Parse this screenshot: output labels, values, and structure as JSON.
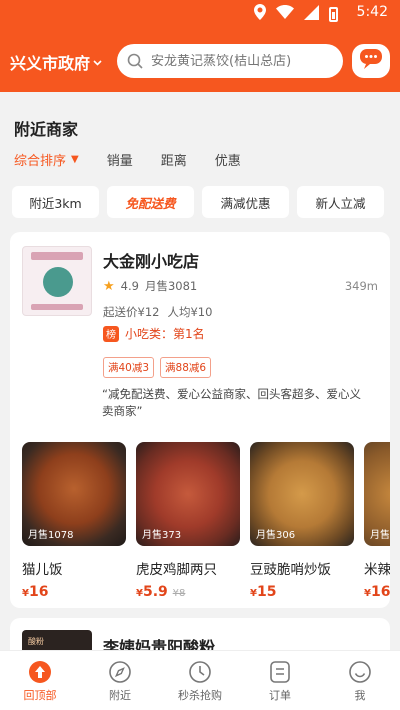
{
  "status_bar": {
    "time": "5:42"
  },
  "header": {
    "city": "兴义市政府",
    "search_placeholder": "安龙黄记蒸饺(桔山总店)"
  },
  "nearby": {
    "title": "附近商家",
    "sort_options": [
      {
        "label": "综合排序",
        "active": true
      },
      {
        "label": "销量"
      },
      {
        "label": "距离"
      },
      {
        "label": "优惠"
      }
    ],
    "filters": [
      {
        "label": "附近3km"
      },
      {
        "label": "免配送费",
        "highlighted": true
      },
      {
        "label": "满减优惠"
      },
      {
        "label": "新人立减"
      }
    ]
  },
  "stores": [
    {
      "name": "大金刚小吃店",
      "rating": "4.9",
      "monthly_sales": "月售3081",
      "distance": "349m",
      "min_order": "起送价¥12",
      "avg_price": "人均¥10",
      "rank_badge": "榜",
      "rank_text": "小吃类：第1名",
      "promotions": [
        "满40减3",
        "满88减6"
      ],
      "quote": "“减免配送费、爱心公益商家、回头客超多、爱心义卖商家”",
      "dishes": [
        {
          "name": "猫儿饭",
          "sales": "月售1078",
          "price": "16",
          "currency": "¥"
        },
        {
          "name": "虎皮鸡脚两只",
          "sales": "月售373",
          "price": "5.9",
          "currency": "¥",
          "original_price": "¥8"
        },
        {
          "name": "豆豉脆哨炒饭",
          "sales": "月售306",
          "price": "15",
          "currency": "¥"
        },
        {
          "name": "米辣",
          "sales": "月售",
          "price": "16",
          "currency": "¥"
        }
      ]
    },
    {
      "name": "李姨妈贵阳酸粉",
      "logo_text": "酸粉"
    }
  ],
  "tabbar": [
    {
      "label": "回顶部",
      "active": true
    },
    {
      "label": "附近"
    },
    {
      "label": "秒杀抢购"
    },
    {
      "label": "订单"
    },
    {
      "label": "我"
    }
  ],
  "colors": {
    "brand": "#f6571f",
    "price": "#e2451a",
    "star": "#f6a01f"
  }
}
